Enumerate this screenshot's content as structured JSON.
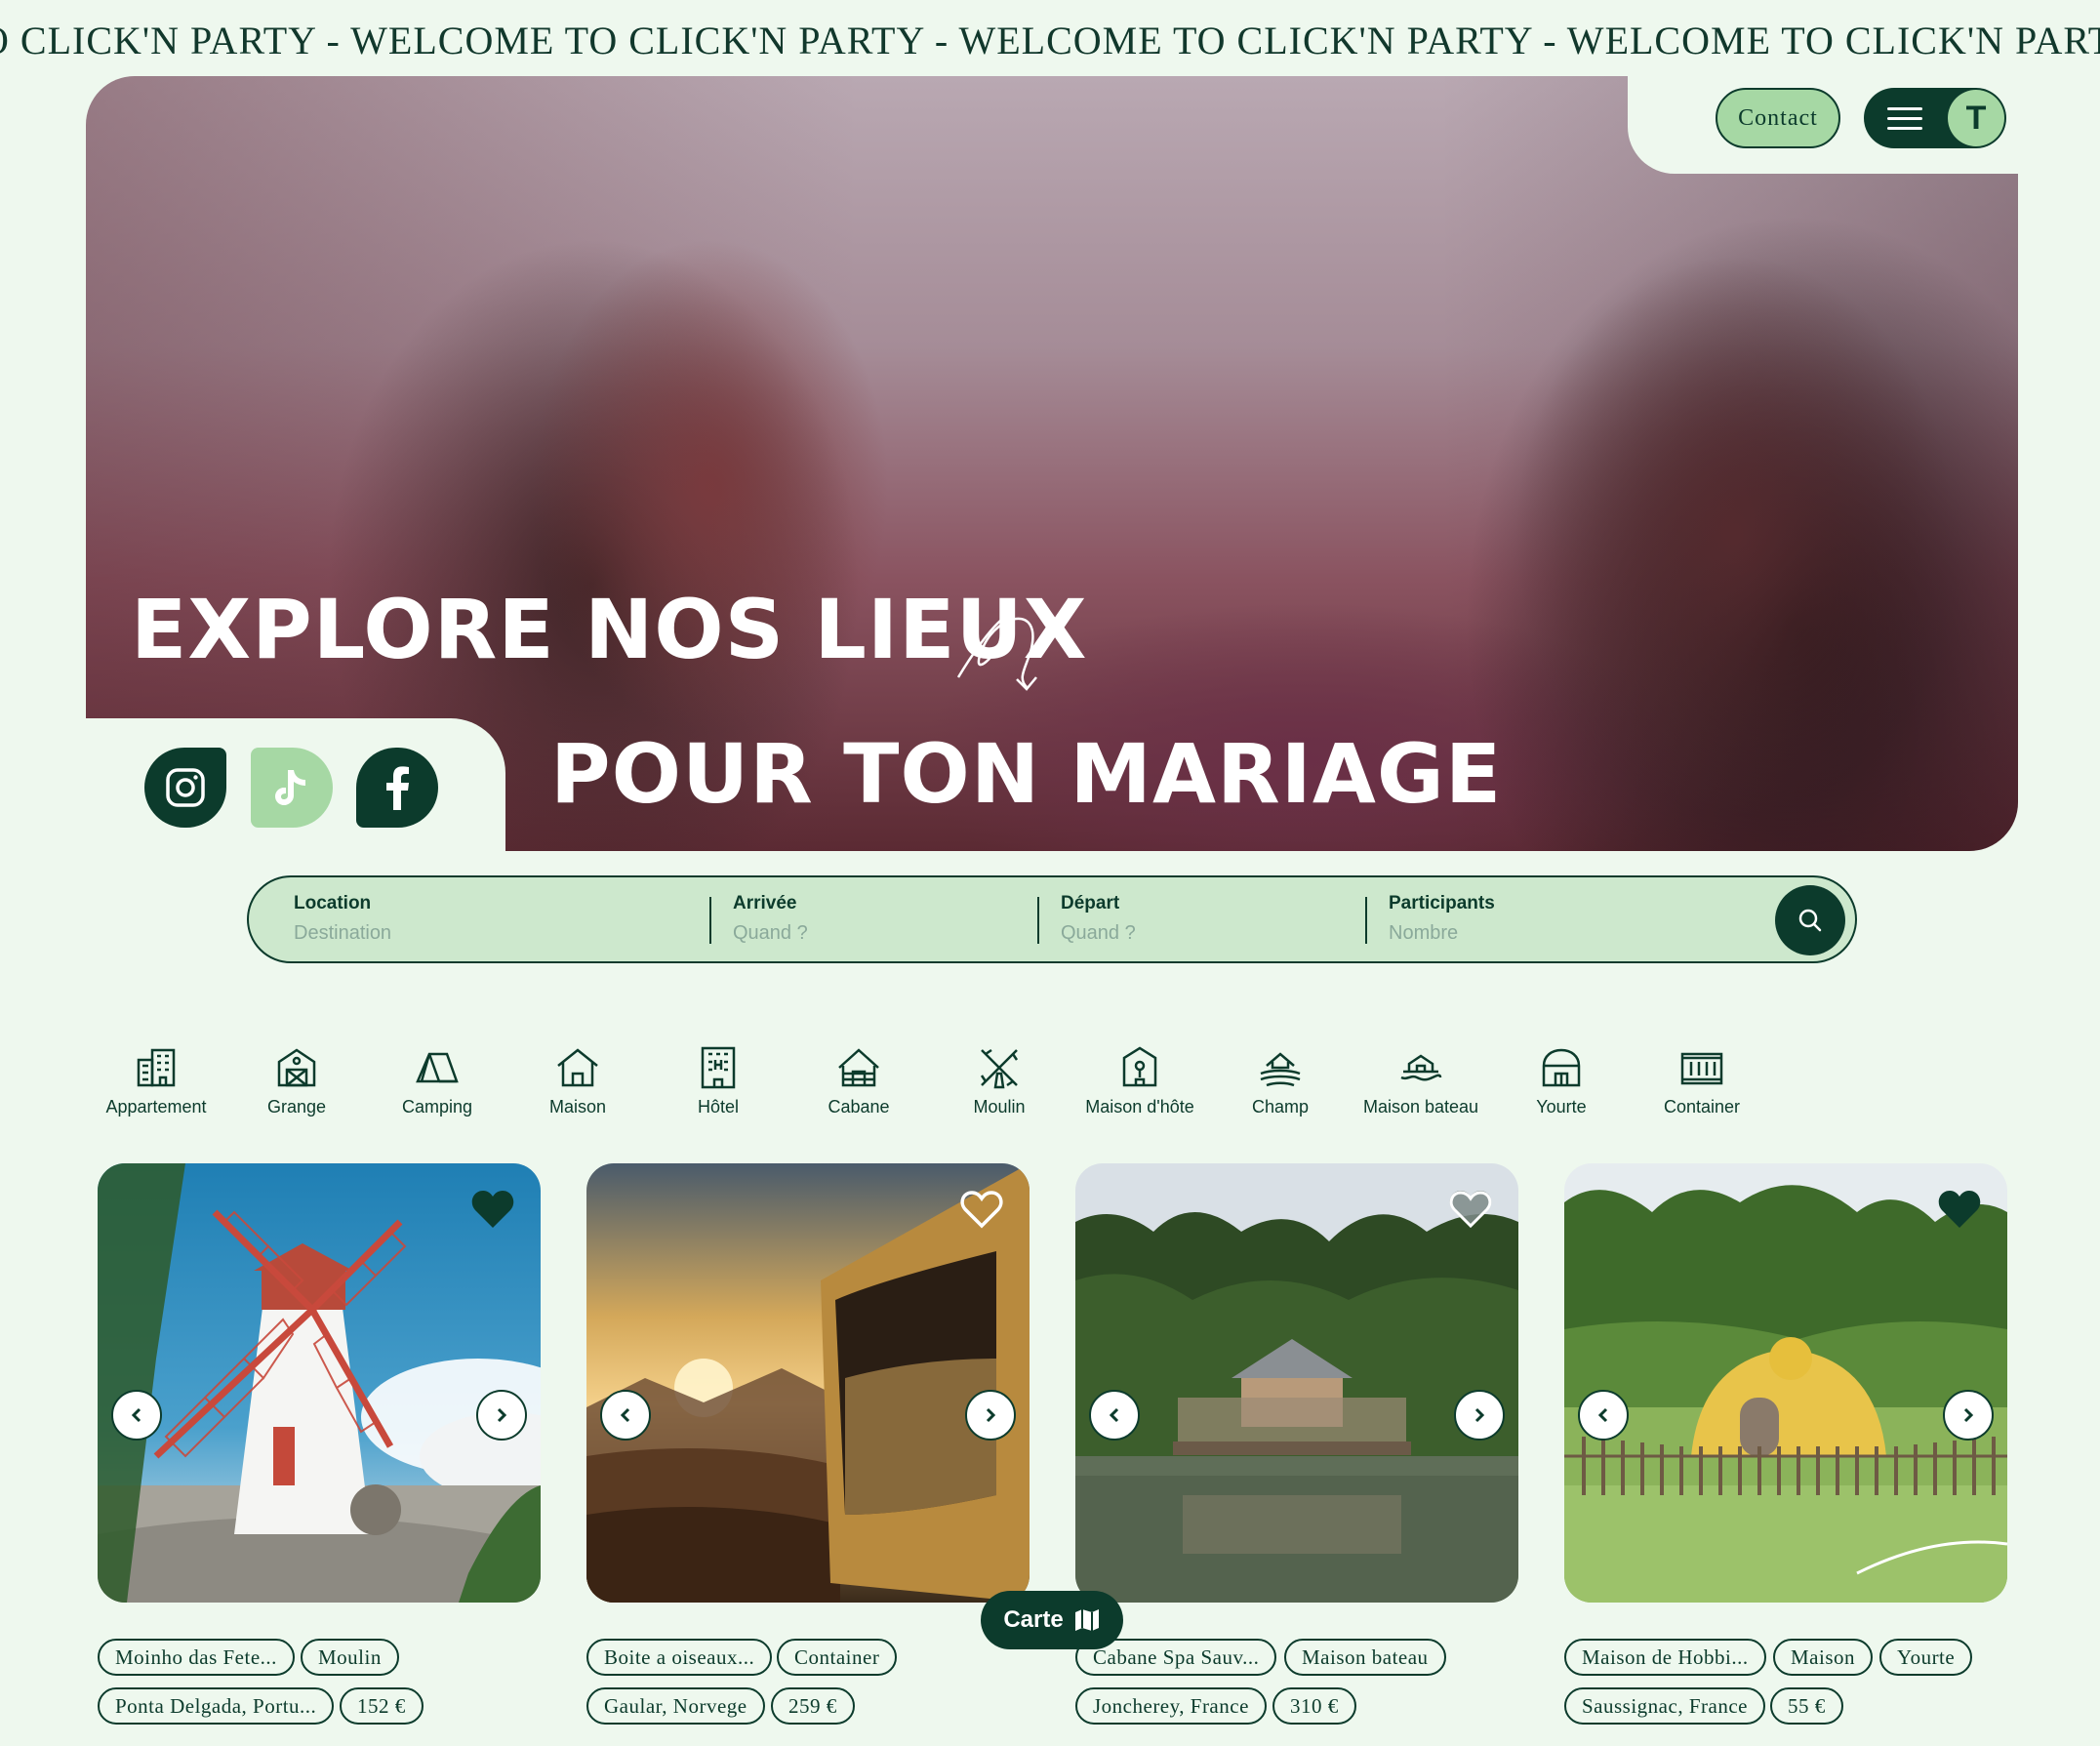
{
  "marquee": {
    "text": "O CLICK'N PARTY - WELCOME TO CLICK'N PARTY - WELCOME TO CLICK'N PARTY - WELCOME TO CLICK'N PARTY - WELCOME TO CL"
  },
  "header": {
    "contact_label": "Contact",
    "avatar_initial": "T"
  },
  "hero": {
    "title_line1": "EXPLORE NOS LIEUX",
    "title_line2": "POUR TON MARIAGE"
  },
  "socials": [
    "instagram-icon",
    "tiktok-icon",
    "facebook-icon"
  ],
  "search": {
    "location_label": "Location",
    "location_placeholder": "Destination",
    "arrival_label": "Arrivée",
    "arrival_placeholder": "Quand ?",
    "departure_label": "Départ",
    "departure_placeholder": "Quand ?",
    "participants_label": "Participants",
    "participants_placeholder": "Nombre"
  },
  "categories": [
    {
      "label": "Appartement",
      "icon": "building-icon"
    },
    {
      "label": "Grange",
      "icon": "barn-icon"
    },
    {
      "label": "Camping",
      "icon": "tent-icon"
    },
    {
      "label": "Maison",
      "icon": "house-icon"
    },
    {
      "label": "Hôtel",
      "icon": "hotel-icon"
    },
    {
      "label": "Cabane",
      "icon": "cabin-icon"
    },
    {
      "label": "Moulin",
      "icon": "windmill-icon"
    },
    {
      "label": "Maison d'hôte",
      "icon": "guesthouse-icon"
    },
    {
      "label": "Champ",
      "icon": "field-icon"
    },
    {
      "label": "Maison bateau",
      "icon": "houseboat-icon"
    },
    {
      "label": "Yourte",
      "icon": "yurt-icon"
    },
    {
      "label": "Container",
      "icon": "container-icon"
    }
  ],
  "cards": [
    {
      "name": "Moinho das Fete...",
      "type": "Moulin",
      "location": "Ponta Delgada, Portu...",
      "price": "152 €",
      "favorite": true
    },
    {
      "name": "Boite a oiseaux...",
      "type": "Container",
      "location": "Gaular, Norvege",
      "price": "259 €",
      "favorite": false
    },
    {
      "name": "Cabane Spa Sauv...",
      "type": "Maison bateau",
      "location": "Joncherey, France",
      "price": "310 €",
      "favorite": false
    },
    {
      "name": "Maison de Hobbi...",
      "type": "Maison",
      "type2": "Yourte",
      "location": "Saussignac, France",
      "price": "55 €",
      "favorite": true
    }
  ],
  "map_button": {
    "label": "Carte"
  },
  "colors": {
    "primary": "#0c3b2c",
    "accent": "#a6d8a4",
    "background": "#eef8ee"
  }
}
